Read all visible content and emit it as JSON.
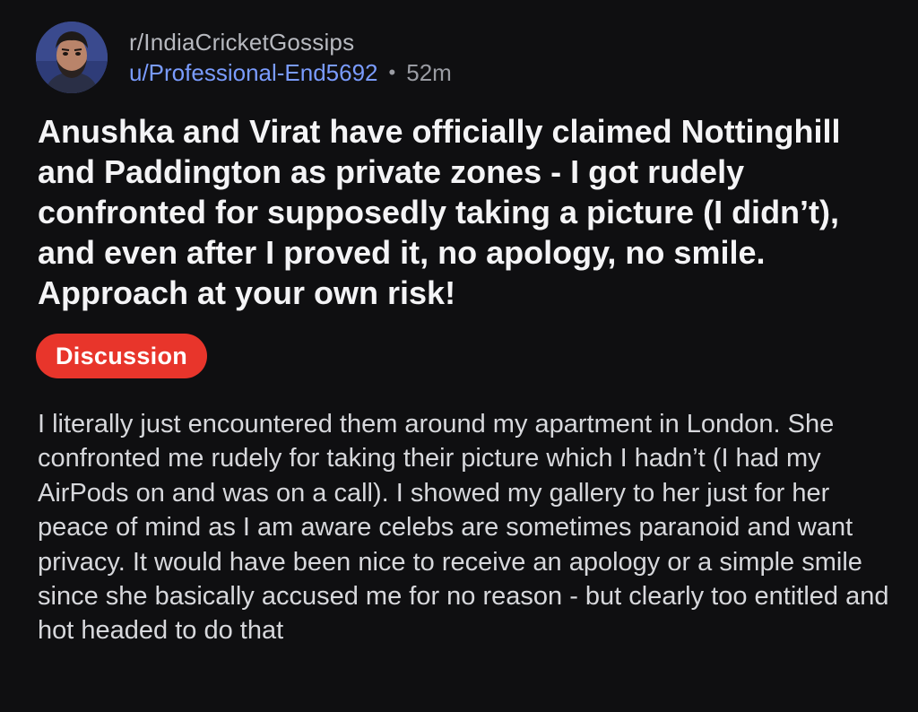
{
  "post": {
    "subreddit": "r/IndiaCricketGossips",
    "username": "u/Professional-End5692",
    "separator": "•",
    "age": "52m",
    "title": "Anushka and Virat have officially claimed Nottinghill and Paddington as private zones - I got rudely confronted for supposedly taking a picture (I didn’t), and even after I proved it, no apology, no smile. Approach at your own risk!",
    "flair": "Discussion",
    "body": "I literally just encountered them around my apartment in London. She confronted me rudely for taking their picture which I hadn’t (I had my AirPods on and was on a call). I showed my gallery to her just for her peace of mind as I am aware celebs are sometimes paranoid and want privacy. It would have been nice to receive an apology or a simple smile since she basically accused me for no reason - but clearly too entitled and hot headed to do that"
  },
  "colors": {
    "background": "#0f0f11",
    "username": "#7a9cff",
    "flair": "#e8352b",
    "title": "#f4f4f6",
    "body": "#d7d8dc",
    "meta": "#9a9ca3"
  }
}
